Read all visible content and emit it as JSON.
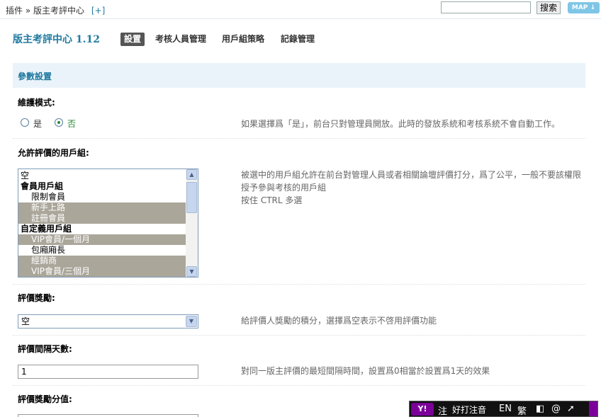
{
  "topbar": {
    "breadcrumb_plugin": "插件",
    "breadcrumb_sep": "»",
    "breadcrumb_current": "版主考評中心",
    "breadcrumb_add": "[+]",
    "search_value": "",
    "search_button": "搜索",
    "map_button": "MAP"
  },
  "header": {
    "app_title": "版主考評中心 1.12",
    "tabs": [
      {
        "label": "設置",
        "active": true
      },
      {
        "label": "考核人員管理",
        "active": false
      },
      {
        "label": "用戶組策略",
        "active": false
      },
      {
        "label": "記錄管理",
        "active": false
      }
    ]
  },
  "section": {
    "title": "參數設置"
  },
  "maintenance": {
    "label": "維護模式:",
    "option_yes": "是",
    "option_no": "否",
    "selected": "否",
    "description": "如果選擇爲「是」，前台只對管理員開放。此時的發放系統和考核系統不會自動工作。"
  },
  "allowed_groups": {
    "label": "允許評價的用戶組:",
    "items": [
      {
        "text": "空",
        "type": "option",
        "selected": false
      },
      {
        "text": "會員用戶組",
        "type": "group",
        "selected": false
      },
      {
        "text": "限制會員",
        "type": "option",
        "selected": false
      },
      {
        "text": "新手上路",
        "type": "option",
        "selected": true
      },
      {
        "text": "註冊會員",
        "type": "option",
        "selected": true
      },
      {
        "text": "自定義用戶組",
        "type": "group",
        "selected": false
      },
      {
        "text": "VIP會員/一個月",
        "type": "option",
        "selected": true
      },
      {
        "text": "包廂廂長",
        "type": "option",
        "selected": false
      },
      {
        "text": "經銷商",
        "type": "option",
        "selected": true
      },
      {
        "text": "VIP會員/三個月",
        "type": "option",
        "selected": true
      }
    ],
    "description_line1": "被選中的用戶組允許在前台對管理人員或者相關論壇評價打分，爲了公平，一般不要該權限",
    "description_line2": "授予參與考核的用戶組",
    "description_line3": "按住 CTRL 多選"
  },
  "reward": {
    "label": "評價獎勵:",
    "selected_value": "空",
    "description": "給評價人獎勵的積分，選擇爲空表示不啓用評價功能"
  },
  "interval": {
    "label": "評價間隔天數:",
    "value": "1",
    "description": "對同一版主評價的最短間隔時間，設置爲0相當於設置爲1天的效果"
  },
  "reward_points": {
    "label": "評價獎勵分值:",
    "value": ""
  },
  "ime_bar": {
    "logo": "Y!",
    "note": "注",
    "mode": "好打注音",
    "lang": "EN",
    "script": "繁"
  }
}
